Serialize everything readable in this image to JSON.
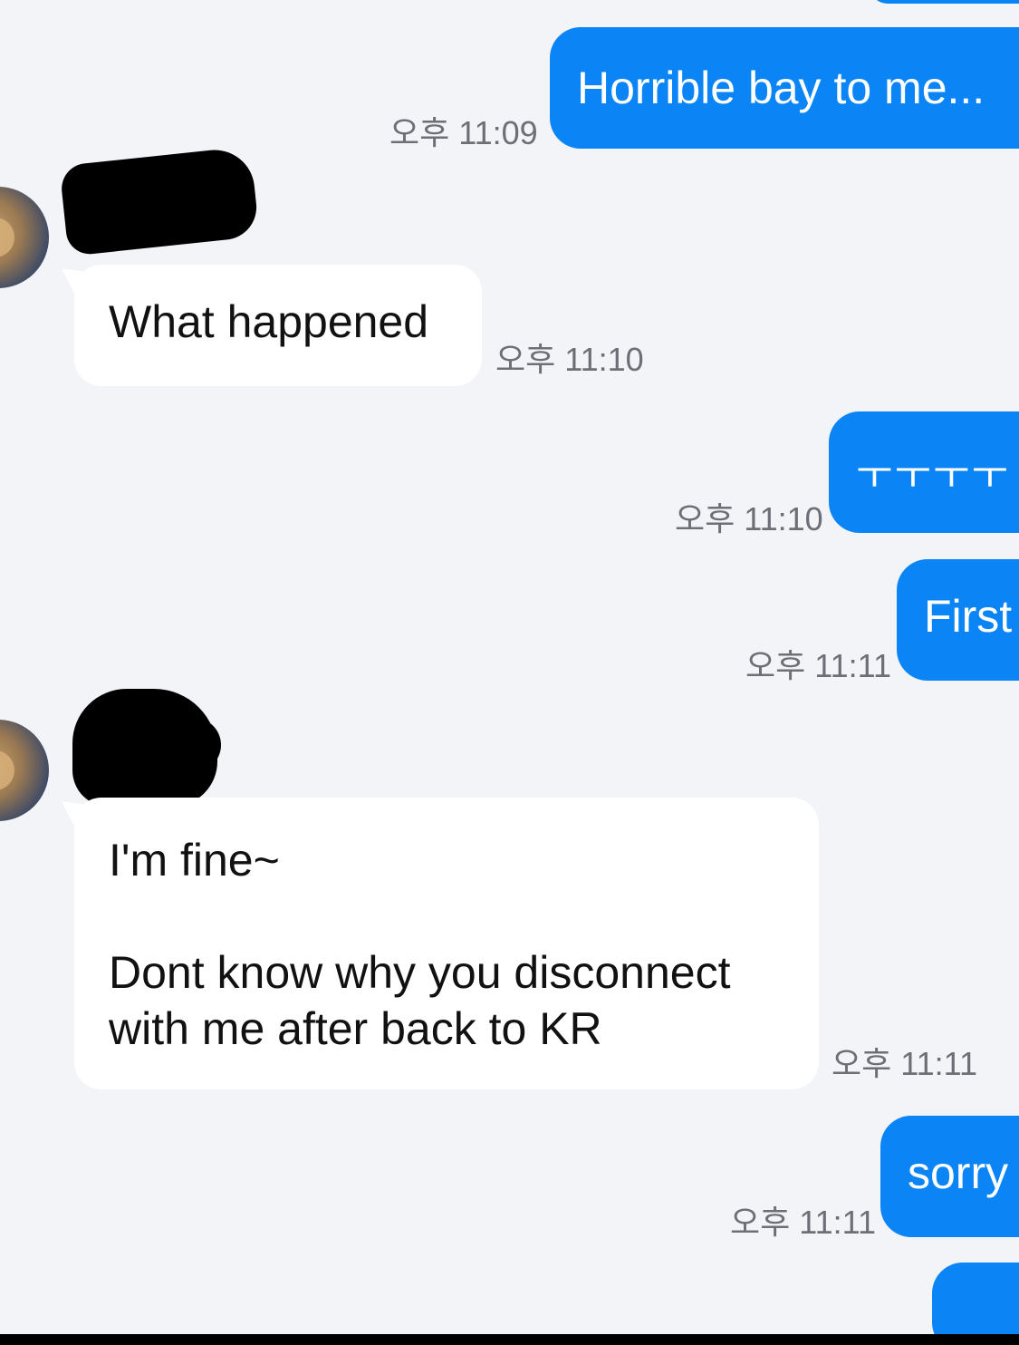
{
  "messages": [
    {
      "id": "m0",
      "direction": "outgoing",
      "text": "",
      "time": ""
    },
    {
      "id": "m1",
      "direction": "outgoing",
      "text": "Horrible bay to me...",
      "time": "오후 11:09"
    },
    {
      "id": "m2",
      "direction": "incoming",
      "text": "What happened",
      "time": "오후 11:10"
    },
    {
      "id": "m3",
      "direction": "outgoing",
      "text": "ㅜㅜㅜㅜ",
      "time": "오후 11:10"
    },
    {
      "id": "m4",
      "direction": "outgoing",
      "text": "First",
      "time": "오후 11:11"
    },
    {
      "id": "m5",
      "direction": "incoming",
      "text": "I'm fine~\n\nDont know why you disconnect with me after back to KR",
      "time": "오후 11:11"
    },
    {
      "id": "m6",
      "direction": "outgoing",
      "text": "sorry",
      "time": "오후 11:11"
    },
    {
      "id": "m7",
      "direction": "outgoing",
      "text": "",
      "time": ""
    }
  ],
  "colors": {
    "background": "#f3f4f8",
    "outgoing_bubble": "#0b84f5",
    "incoming_bubble": "#ffffff",
    "timestamp": "#6d6f76"
  },
  "icons": {
    "avatar": "contact-avatar-photo",
    "redaction": "black-redaction-mark"
  }
}
